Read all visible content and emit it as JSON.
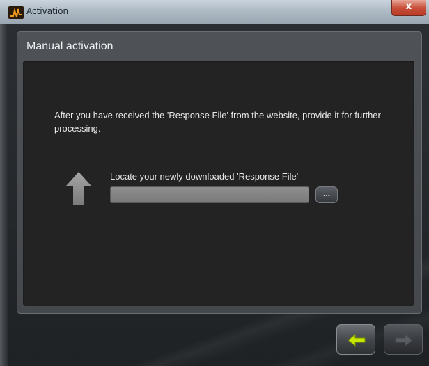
{
  "window": {
    "title": "Activation",
    "close_label": "x"
  },
  "panel": {
    "title": "Manual activation",
    "instruction": "After you have received the 'Response File' from the website, provide it for further processing."
  },
  "response_file": {
    "label": "Locate your newly downloaded 'Response File'",
    "value": "",
    "browse_label": "..."
  },
  "navigation": {
    "back_icon": "left-arrow-icon",
    "back_color": "#c6e800",
    "next_icon": "right-arrow-icon",
    "next_enabled": false
  },
  "colors": {
    "app_icon_accent": "#e08a10",
    "close_button": "#c9503b"
  }
}
